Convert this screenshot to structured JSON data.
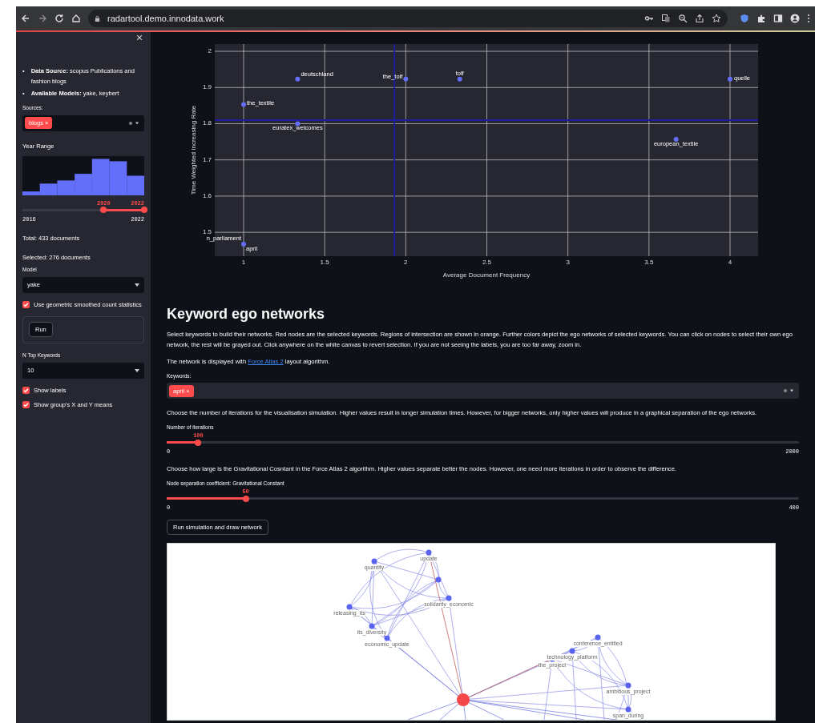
{
  "browser": {
    "url": "radartool.demo.innodata.work"
  },
  "sidebar": {
    "info": [
      {
        "bullet": "•",
        "label": "Data Source:",
        "value": "scopus Publications and fashion blogs"
      },
      {
        "bullet": "•",
        "label": "Available Models:",
        "value": "yake, keybert"
      }
    ],
    "sources": {
      "label": "Sources:",
      "tags": [
        {
          "label": "blogs",
          "close": "×"
        }
      ]
    },
    "year_range": {
      "label": "Year Range",
      "start": {
        "value": "2020",
        "level": 0.667
      },
      "end": {
        "value": "2022",
        "level": 1
      },
      "min": "2016",
      "max": "2022"
    },
    "total": "Total: 433 documents",
    "selected": "Selected: 276 documents",
    "model": {
      "label": "Model",
      "value": "yake"
    },
    "smoothed": {
      "label": "Use geometric smoothed count statistics",
      "checked": true
    },
    "run_button": "Run",
    "top_keywords": {
      "label": "N Top Keywords",
      "value": "10"
    },
    "options": [
      {
        "label": "Show labels",
        "checked": true
      },
      {
        "label": "Show group's X and Y means",
        "checked": true
      }
    ]
  },
  "chart": {
    "chart_data": {
      "type": "scatter",
      "xlabel": "Average Document Frequency",
      "ylabel": "Time Weighted Increasing Rate",
      "xlim": [
        0.822,
        4.173
      ],
      "ylim": [
        1.434,
        2.02
      ],
      "xticks": [
        {
          "value": 1,
          "label": "1"
        },
        {
          "value": 1.5,
          "label": "1.5"
        },
        {
          "value": 2,
          "label": "2"
        },
        {
          "value": 2.5,
          "label": "2.5"
        },
        {
          "value": 3,
          "label": "3"
        },
        {
          "value": 3.5,
          "label": "3.5"
        },
        {
          "value": 4,
          "label": "4"
        }
      ],
      "yticks": [
        {
          "value": 1.5,
          "label": "1.5"
        },
        {
          "value": 1.6,
          "label": "1.6"
        },
        {
          "value": 1.7,
          "label": "1.7"
        },
        {
          "value": 1.8,
          "label": "1.8"
        },
        {
          "value": 1.9,
          "label": "1.9"
        },
        {
          "value": 2,
          "label": "2"
        }
      ],
      "x": [
        1.333,
        2,
        2.333,
        4,
        1,
        1.333,
        3.667,
        1
      ],
      "grid": true,
      "series": [
        {
          "color": "#636efa",
          "values": [
            1.923,
            1.923,
            1.923,
            1.923,
            1.853,
            1.8,
            1.757,
            1.467
          ]
        }
      ],
      "annotations": [
        {
          "x": 1.333,
          "y": 1.923,
          "text": "deutschland"
        },
        {
          "x": 2,
          "y": 1.923,
          "text": "the_tolf"
        },
        {
          "x": 2.333,
          "y": 1.923,
          "text": "tolf"
        },
        {
          "x": 4,
          "y": 1.923,
          "text": "quelle"
        },
        {
          "x": 1,
          "y": 1.853,
          "text": "the_textile"
        },
        {
          "x": 1.333,
          "y": 1.8,
          "text": "euratex_welcomes"
        },
        {
          "x": 3.667,
          "y": 1.757,
          "text": "european_textile"
        },
        {
          "x": 1,
          "y": 1.467,
          "text": "n_parliament"
        },
        {
          "x": 1,
          "y": 1.467,
          "text": "april"
        }
      ],
      "ref_lines": [
        {
          "axis": "x",
          "value": 1.93,
          "color": "#1d1d9e"
        },
        {
          "axis": "y",
          "value": 1.81,
          "color": "#1d1d9e"
        }
      ]
    }
  },
  "section": {
    "title": "Keyword ego networks",
    "intro": "Select keywords to build their networks. Red nodes are the selected keywords. Regions of intersection are shown in orange. Further colors depict the ego networks of selected keywords. You can click on nodes to select their own ego network, the rest will be grayed out. Click anywhere on the white canvas to revert selection. If you are not seeing the labels, you are too far away, zoom in.",
    "layout_note": {
      "before": "The network is displayed with",
      "link": "Force Atlas 2",
      "after": "layout algorithm."
    },
    "keywords": {
      "label": "Keywords:",
      "tags": [
        {
          "label": "april",
          "close": "×"
        }
      ]
    },
    "iterations_help": "Choose the number of iterations for the visualisation simulation. Higher values result in longer simulation times. However, for bigger networks, only higher values will produce in a graphical separation of the ego networks.",
    "iterations": {
      "label": "Number of iterations",
      "value": "100",
      "level": 0.05,
      "min": "0",
      "max": "2000"
    },
    "gravity_help": "Choose how large is the Gravitational Cosntant in the Force Atlas 2 algorithm. Higher values separate better the nodes. However, one need more iterations in order to observe the difference.",
    "gravity": {
      "label": "Node separation coefficient: Gravitational Constant",
      "value": "50",
      "level": 0.125,
      "min": "0",
      "max": "400"
    },
    "draw_button": "Run simulation and draw network"
  },
  "network": {
    "nodes": [
      {
        "label": "quantity"
      },
      {
        "label": "update"
      },
      {
        "label": "solidarity_economic"
      },
      {
        "label": "releasing_its"
      },
      {
        "label": "its_diversity"
      },
      {
        "label": "economic_update"
      },
      {
        "label": "conference_entitled"
      },
      {
        "label": "technology_platform"
      },
      {
        "label": "the_project"
      },
      {
        "label": "ambitious_project"
      },
      {
        "label": "span_during"
      }
    ]
  }
}
